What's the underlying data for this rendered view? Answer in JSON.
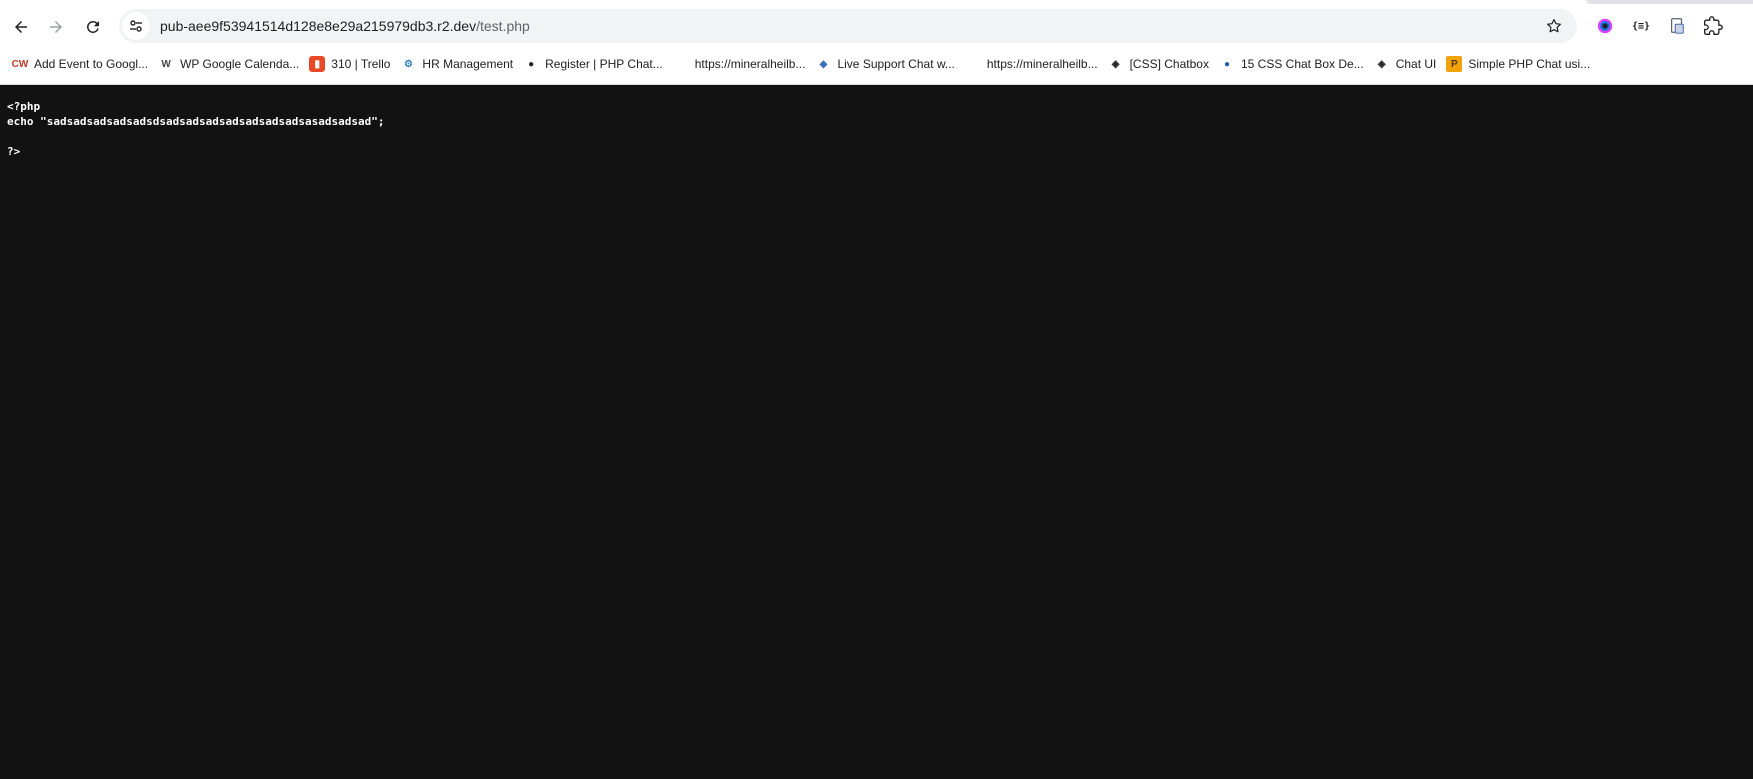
{
  "browser": {
    "url_host": "pub-aee9f53941514d128e8e29a215979db3.r2.dev",
    "url_path": "/test.php"
  },
  "bookmarks": [
    {
      "label": "Add Event to Googl...",
      "icon": "cw-icon",
      "color": "#c0392b"
    },
    {
      "label": "WP Google Calenda...",
      "icon": "wordpress-icon",
      "color": "#464646"
    },
    {
      "label": "310 | Trello",
      "icon": "trello-icon",
      "color": "#e84a27"
    },
    {
      "label": "HR Management",
      "icon": "hr-icon",
      "color": "#3c7fc5"
    },
    {
      "label": "Register | PHP Chat...",
      "icon": "globe-icon",
      "color": "#202124"
    },
    {
      "label": "https://mineralheilb...",
      "icon": "blank-icon",
      "color": "#ffffff"
    },
    {
      "label": "Live Support Chat w...",
      "icon": "chat-icon",
      "color": "#3b6fb6"
    },
    {
      "label": "https://mineralheilb...",
      "icon": "blank-icon",
      "color": "#ffffff"
    },
    {
      "label": "[CSS] Chatbox",
      "icon": "codepen-icon",
      "color": "#202124"
    },
    {
      "label": "15 CSS Chat Box De...",
      "icon": "avatar-icon",
      "color": "#1e5fa8"
    },
    {
      "label": "Chat UI",
      "icon": "codepen-icon",
      "color": "#202124"
    },
    {
      "label": "Simple PHP Chat usi...",
      "icon": "php-chat-icon",
      "color": "#f0a30a"
    }
  ],
  "page": {
    "code_lines": [
      "<?php",
      "echo \"sadsadsadsadsadsdsadsadsadsadsadsadsadsasadsadsad\";",
      "",
      "?>"
    ]
  }
}
